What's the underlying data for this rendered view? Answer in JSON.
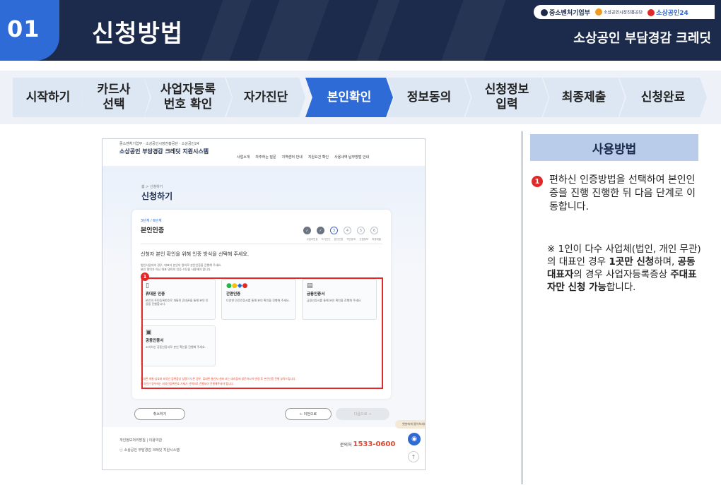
{
  "header": {
    "number": "01",
    "title": "신청방법",
    "subtitle": "소상공인 부담경감 크레딧",
    "logos": {
      "logo1": "중소벤처기업부",
      "logo2": "소상공인시장진흥공단",
      "logo3": "소상공인24"
    }
  },
  "steps": [
    {
      "label": "시작하기",
      "active": false
    },
    {
      "label": "카드사\n선택",
      "active": false
    },
    {
      "label": "사업자등록\n번호 확인",
      "active": false
    },
    {
      "label": "자가진단",
      "active": false
    },
    {
      "label": "본인확인",
      "active": true
    },
    {
      "label": "정보동의",
      "active": false
    },
    {
      "label": "신청정보\n입력",
      "active": false
    },
    {
      "label": "최종제출",
      "active": false
    },
    {
      "label": "신청완료",
      "active": false
    }
  ],
  "screenshot": {
    "logos": "중소벤처기업부 · 소상공인시장진흥공단 · 소상공인24",
    "system_name": "소상공인 부담경감 크레딧 지원시스템",
    "nav": [
      "사업소개",
      "자주하는 질문",
      "지역센터 안내",
      "지원요건 확인",
      "사용내역·납부방법 안내"
    ],
    "breadcrumb": "홈 > 신청하기",
    "page_heading": "신청하기",
    "stage": "3단계 / 6단계",
    "stage_title": "본인인증",
    "progress": [
      {
        "mark": "✓",
        "label": "사업자번호",
        "status": "done"
      },
      {
        "mark": "✓",
        "label": "자가진단",
        "status": "done"
      },
      {
        "mark": "3",
        "label": "본인인증",
        "status": "current"
      },
      {
        "mark": "4",
        "label": "약관동의",
        "status": "todo"
      },
      {
        "mark": "5",
        "label": "신청정보",
        "status": "todo"
      },
      {
        "mark": "6",
        "label": "최종제출",
        "status": "todo"
      }
    ],
    "instruction": "신청자 본인 확인을 위해 인증 방식을 선택해 주세요.",
    "note1": "법인사업자의 경우, 대표자 본인의 명의로 본인인증을 진행해 주세요.",
    "note2": "본인 명의가 아닌 대표 명의의 인증 수단을 사용해야 합니다.",
    "options": [
      {
        "icon": "휴",
        "title": "휴대폰 인증",
        "desc": "본인의 주민등록번호로 개통된 휴대폰을 통해 본인 인증을 진행합니다."
      },
      {
        "icon": "N",
        "title": "간편인증",
        "desc": "다양한 민간인증서를 통해 본인 확인을 진행해 주세요."
      },
      {
        "icon": "금",
        "title": "금융인증서",
        "desc": "금융인증서를 통해 본인 확인을 진행해 주세요."
      },
      {
        "icon": "공",
        "title": "공동인증서",
        "desc": "소지하신 공동인증서로 본인 확인을 진행해 주세요."
      }
    ],
    "warning1": "휴대폰 개통·상호와 외국인 등록증상 성명이 다른 경우, 휴대폰 통신사 센터 또는 대리점에 방문하시어 변경 후 본인인증 진행 부탁드립니다.",
    "warning2": "외국인인 경우에는 외국인등록번호 기재가 선택으로 진행되어 진행해주셔야 합니다.",
    "cancel_label": "취소하기",
    "prev_label": "← 이전으로",
    "next_label": "다음으로 →",
    "footer_links": "개인정보처리방침 | 이용약관",
    "footer_org": "ⓒ 소상공인 부담경감 크레딧 지원시스템",
    "tel_label": "문의처",
    "tel_number": "1533-0600",
    "chat_tip": "챗봇에게 물어보세요!",
    "red_badge": "1"
  },
  "usage": {
    "title": "사용방법",
    "badge": "1",
    "step_text": "편하신 인증방법을 선택하여 본인인증을 진행 진행한 뒤 다음 단계로 이동합니다.",
    "memo_parts": [
      "※ 1인이 다수 사업체(법인, 개인 무관)의 대표인 경우 ",
      "1곳만 신청",
      "하며, ",
      "공동 대표자",
      "의 경우 사업자등록증상 ",
      "주대표자만 신청 가능",
      "합니다."
    ]
  },
  "colors": {
    "navy": "#1c2b4c",
    "accent_blue": "#2f6bd6",
    "step_bg": "#dde7f4",
    "highlight_red": "#e02a2a",
    "usage_bg": "#b9ccea"
  }
}
